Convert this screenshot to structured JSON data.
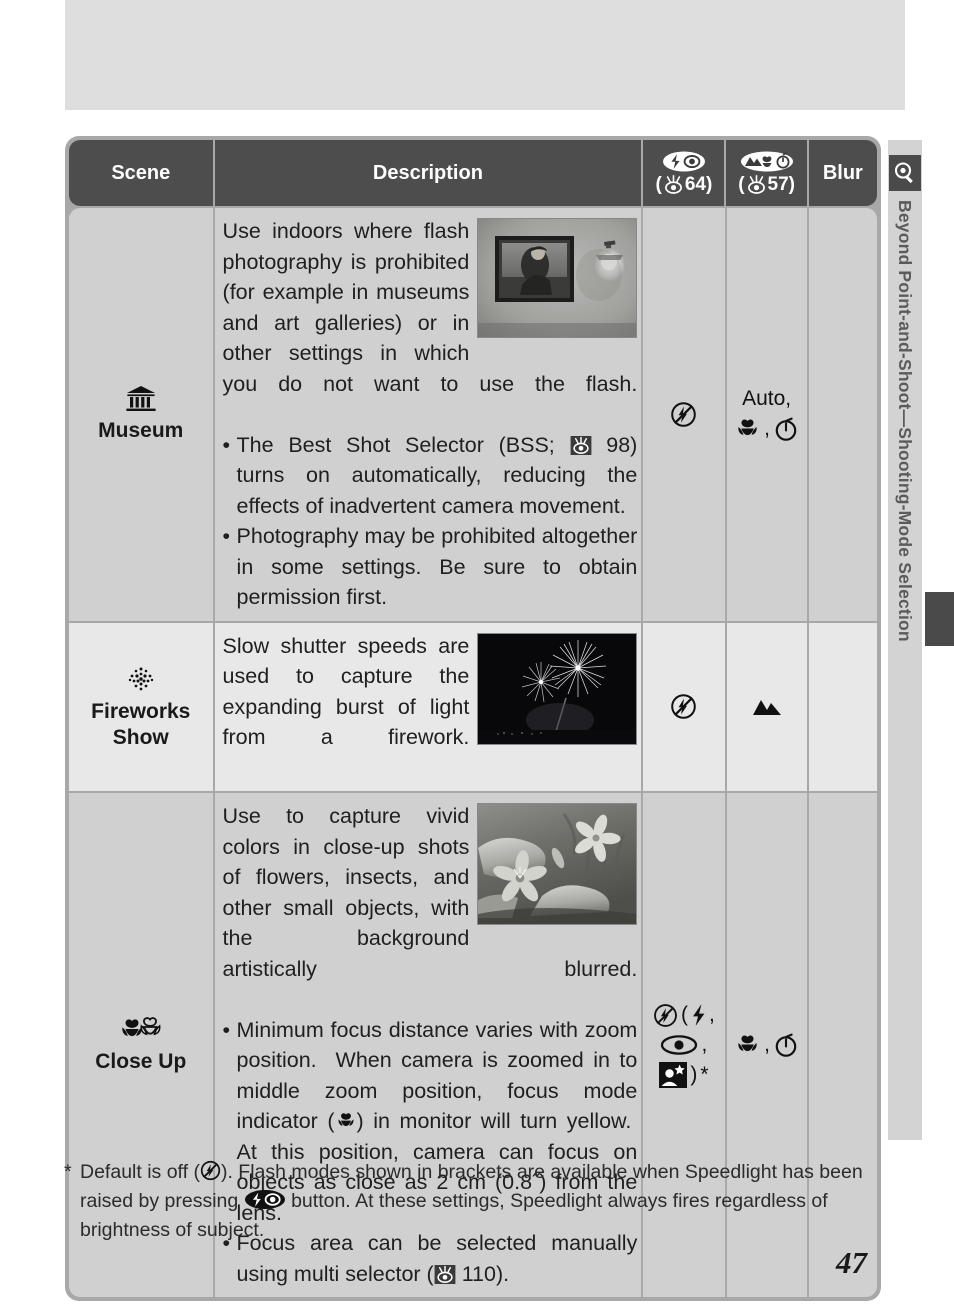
{
  "sidebar": {
    "label": "Beyond Point-and-Shoot—Shooting-Mode Selection",
    "icon": "magnifier-icon"
  },
  "page_number": "47",
  "table": {
    "headers": {
      "scene": "Scene",
      "description": "Description",
      "flash": {
        "icons": "flash-redeye-icon",
        "ref": "64",
        "ref_icon": "eye-book-icon"
      },
      "shooting": {
        "icons": "mountain-flower-timer-icon",
        "ref": "57",
        "ref_icon": "eye-book-icon"
      },
      "blur": "Blur"
    },
    "rows": [
      {
        "scene_icon": "museum-building-icon",
        "scene_name": "Museum",
        "photo": "museum-painting-photo",
        "description_intro": "Use indoors where flash photography is prohibited (for example in museums and art galleries) or in other settings in which you do not want to use the flash.",
        "bullets": [
          "The Best Shot Selector (BSS;  98) turns on automatically, reducing the effects of inadvertent camera movement.",
          "Photography may be prohibited altogether in some settings.  Be sure to obtain permission first."
        ],
        "bullet_refs": [
          "98",
          ""
        ],
        "flash": [
          "flash-off-icon"
        ],
        "shooting_text": "Auto,",
        "shooting_icons": [
          "macro-flower-icon",
          "self-timer-icon"
        ],
        "blur": ""
      },
      {
        "scene_icon": "fireworks-icon",
        "scene_name": "Fireworks Show",
        "photo": "fireworks-photo",
        "description_intro": "Slow shutter speeds are used to capture the expanding burst of light from a firework.",
        "bullets": [],
        "bullet_refs": [],
        "flash": [
          "flash-off-icon"
        ],
        "shooting_text": "",
        "shooting_icons": [
          "infinity-mountain-icon"
        ],
        "blur": ""
      },
      {
        "scene_icon": "close-up-flowers-icon",
        "scene_name": "Close Up",
        "photo": "flowers-closeup-photo",
        "description_intro": "Use to capture vivid colors in close-up shots of flowers, insects, and other small objects, with the background artistically blurred.",
        "bullets": [
          "Minimum focus distance varies with zoom position.  When camera is zoomed in to middle zoom position, focus mode indicator () in monitor will turn yellow.  At this position, camera can focus on objects as close as 2 cm (0.8˝) from the lens.",
          "Focus area can be selected manually using multi selector ( 110)."
        ],
        "bullet_refs": [
          "",
          "110"
        ],
        "flash": [
          "flash-off-icon",
          "flash-fill-icon",
          "red-eye-icon",
          "night-portrait-icon"
        ],
        "flash_asterisk": "*",
        "shooting_text": "",
        "shooting_icons": [
          "macro-flower-icon",
          "self-timer-icon"
        ],
        "blur": ""
      }
    ]
  },
  "footnote": {
    "star": "*",
    "part1": "Default is off (",
    "icon1": "flash-off-icon",
    "part2": ").  Flash modes shown in brackets are available when Speedlight has been raised by pressing ",
    "icon2": "flash-redeye-button-icon",
    "part3": " button.  At these settings, Speedlight always fires regardless of brightness of subject."
  },
  "colors": {
    "header_bg": "#4d4d4d",
    "table_border": "#a8a8a8",
    "row_dark": "#d0d0d0",
    "row_light": "#e8e8e8",
    "band": "#dedede",
    "sidebar": "#d3d3d3",
    "sidebar_text": "#5b5b5b"
  }
}
